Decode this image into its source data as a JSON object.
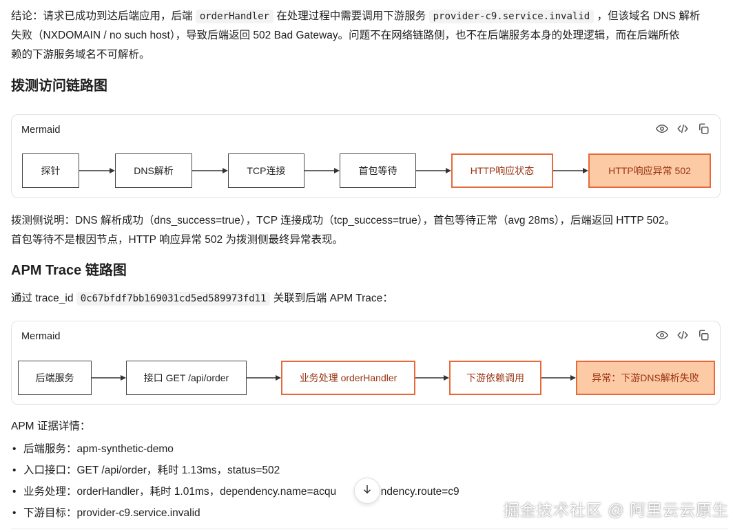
{
  "conclusion": {
    "prefix": "结论：请求已成功到达后端应用，后端 ",
    "handler_code": "orderHandler",
    "middle": " 在处理过程中需要调用下游服务 ",
    "domain_code": "provider-c9.service.invalid",
    "line1_tail": " ，但该域名 DNS 解析",
    "line2": "失败（NXDOMAIN / no such host），导致后端返回 502 Bad Gateway。问题不在网络链路侧，也不在后端服务本身的处理逻辑，而在后端所依",
    "line3": "赖的下游服务域名不可解析。"
  },
  "section1": {
    "heading": "拨测访问链路图",
    "card_title": "Mermaid",
    "nodes": [
      "探针",
      "DNS解析",
      "TCP连接",
      "首包等待",
      "HTTP响应状态",
      "HTTP响应异常 502"
    ],
    "desc_line1": "拨测侧说明：DNS 解析成功（dns_success=true），TCP 连接成功（tcp_success=true），首包等待正常（avg 28ms），后端返回 HTTP 502。",
    "desc_line2": "首包等待不是根因节点，HTTP 响应异常 502 为拨测侧最终异常表现。"
  },
  "section2": {
    "heading": "APM Trace 链路图",
    "intro_prefix": "通过 trace_id ",
    "trace_id": "0c67bfdf7bb169031cd5ed589973fd11",
    "intro_suffix": " 关联到后端 APM Trace：",
    "card_title": "Mermaid",
    "nodes": [
      "后端服务",
      "接口 GET /api/order",
      "业务处理 orderHandler",
      "下游依赖调用",
      "异常：下游DNS解析失败"
    ]
  },
  "evidence": {
    "title": "APM 证据详情：",
    "items": [
      "后端服务：apm-synthetic-demo",
      "入口接口：GET /api/order，耗时 1.13ms，status=502",
      "业务处理：orderHandler，耗时 1.01ms，dependency.name=acqu       dependency.route=c9",
      "下游目标：provider-c9.service.invalid"
    ]
  },
  "icons": [
    "eye-icon",
    "code-icon",
    "copy-icon",
    "arrow-down-icon"
  ],
  "watermark": "掘金技术社区 @ 阿里云云原生",
  "colors": {
    "accent": "#e8693a",
    "error_fill": "#fdcaa6",
    "error_text": "#9a3412"
  }
}
